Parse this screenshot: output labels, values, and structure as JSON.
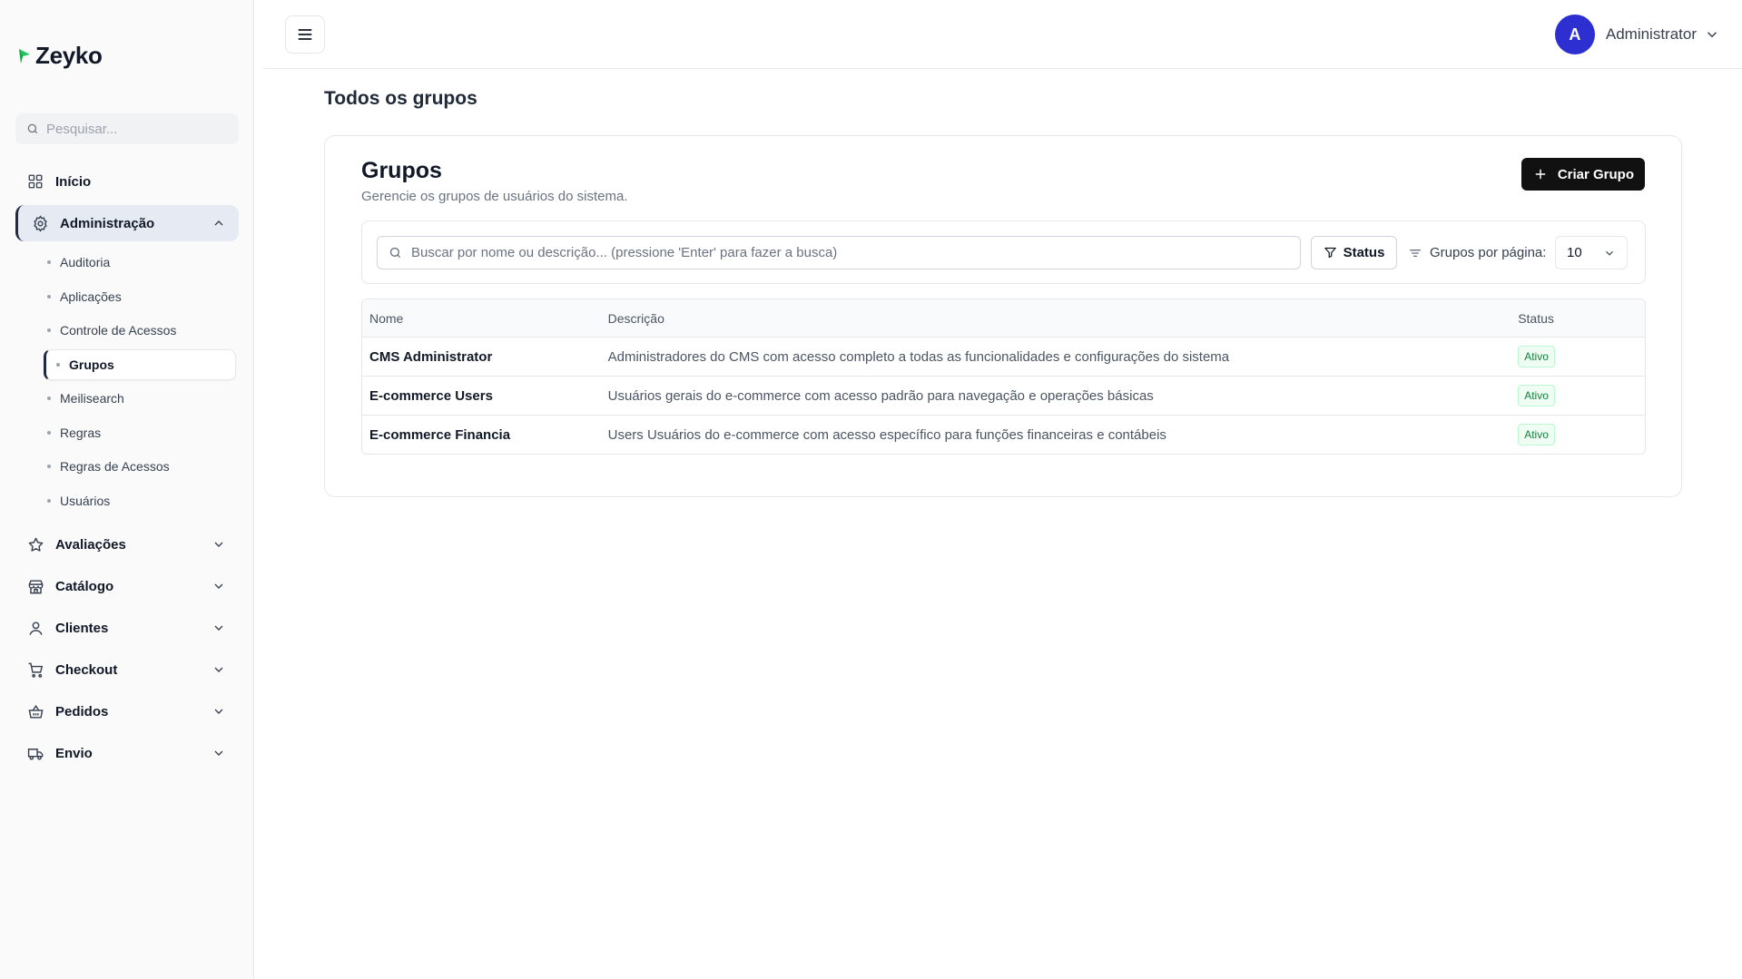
{
  "brand": {
    "name": "Zeyko",
    "accent": "#22c55e"
  },
  "sidebar": {
    "search_placeholder": "Pesquisar...",
    "home": "Início",
    "admin": {
      "label": "Administração",
      "items": [
        "Auditoria",
        "Aplicações",
        "Controle de Acessos",
        "Grupos",
        "Meilisearch",
        "Regras",
        "Regras de Acessos",
        "Usuários"
      ],
      "active": "Grupos"
    },
    "sections": [
      "Avaliações",
      "Catálogo",
      "Clientes",
      "Checkout",
      "Pedidos",
      "Envio"
    ]
  },
  "header": {
    "user_initial": "A",
    "user_name": "Administrator",
    "avatar_color": "#2d2fd1"
  },
  "page": {
    "title": "Todos os grupos"
  },
  "card": {
    "title": "Grupos",
    "subtitle": "Gerencie os grupos de usuários do sistema.",
    "create_label": "Criar Grupo",
    "search_placeholder": "Buscar por nome ou descrição... (pressione 'Enter' para fazer a busca)",
    "status_filter_label": "Status",
    "per_page_label": "Grupos por página:",
    "per_page_value": "10"
  },
  "table": {
    "headers": [
      "Nome",
      "Descrição",
      "Status"
    ],
    "rows": [
      {
        "name": "CMS Administrator",
        "description": "Administradores do CMS com acesso completo a todas as funcionalidades e configurações do sistema",
        "status": "Ativo"
      },
      {
        "name": "E-commerce Users",
        "description": "Usuários gerais do e-commerce com acesso padrão para navegação e operações básicas",
        "status": "Ativo"
      },
      {
        "name": "E-commerce Financia",
        "description": "Users Usuários do e-commerce com acesso específico para funções financeiras e contábeis",
        "status": "Ativo"
      }
    ]
  }
}
